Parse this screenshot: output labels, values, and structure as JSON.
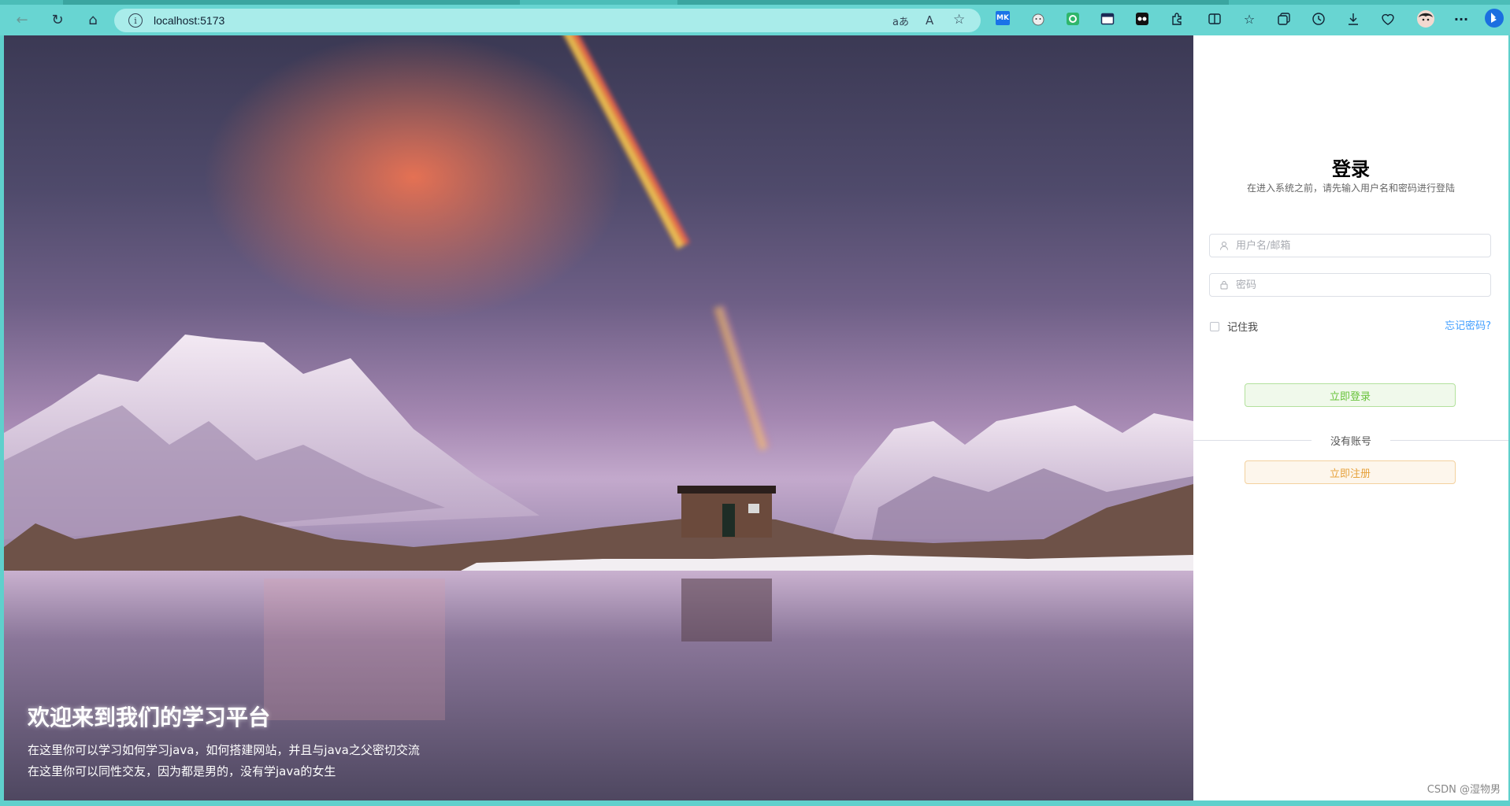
{
  "browser": {
    "url": "localhost:5173",
    "info_icon": "i",
    "translate_icon": "aあ",
    "read_aloud_icon": "A",
    "favorite_icon": "☆"
  },
  "toolbar_icons": [
    "back-icon",
    "refresh-icon",
    "home-icon",
    "extension-mk-icon",
    "extension-cat-icon",
    "extension-green-icon",
    "extension-window-icon",
    "extension-panda-icon",
    "extensions-icon",
    "split-screen-icon",
    "favorites-icon",
    "collections-icon",
    "history-icon",
    "downloads-icon",
    "browser-essentials-icon",
    "profile-avatar-icon",
    "more-icon",
    "bing-icon"
  ],
  "hero": {
    "title": "欢迎来到我们的学习平台",
    "line1": "在这里你可以学习如何学习java，如何搭建网站，并且与java之父密切交流",
    "line2": "在这里你可以同性交友，因为都是男的，没有学java的女生"
  },
  "login": {
    "title": "登录",
    "subtitle": "在进入系统之前，请先输入用户名和密码进行登陆",
    "username_placeholder": "用户名/邮箱",
    "password_placeholder": "密码",
    "remember_label": "记住我",
    "remember_checked": false,
    "forgot_link": "忘记密码?",
    "login_button": "立即登录",
    "divider_text": "没有账号",
    "register_button": "立即注册"
  },
  "watermark": "CSDN @湿物男",
  "colors": {
    "browser_chrome": "#68d5d2",
    "address_bar": "#a9ecea",
    "link": "#409eff",
    "success": "#67c23a",
    "warning": "#e6a23c"
  }
}
